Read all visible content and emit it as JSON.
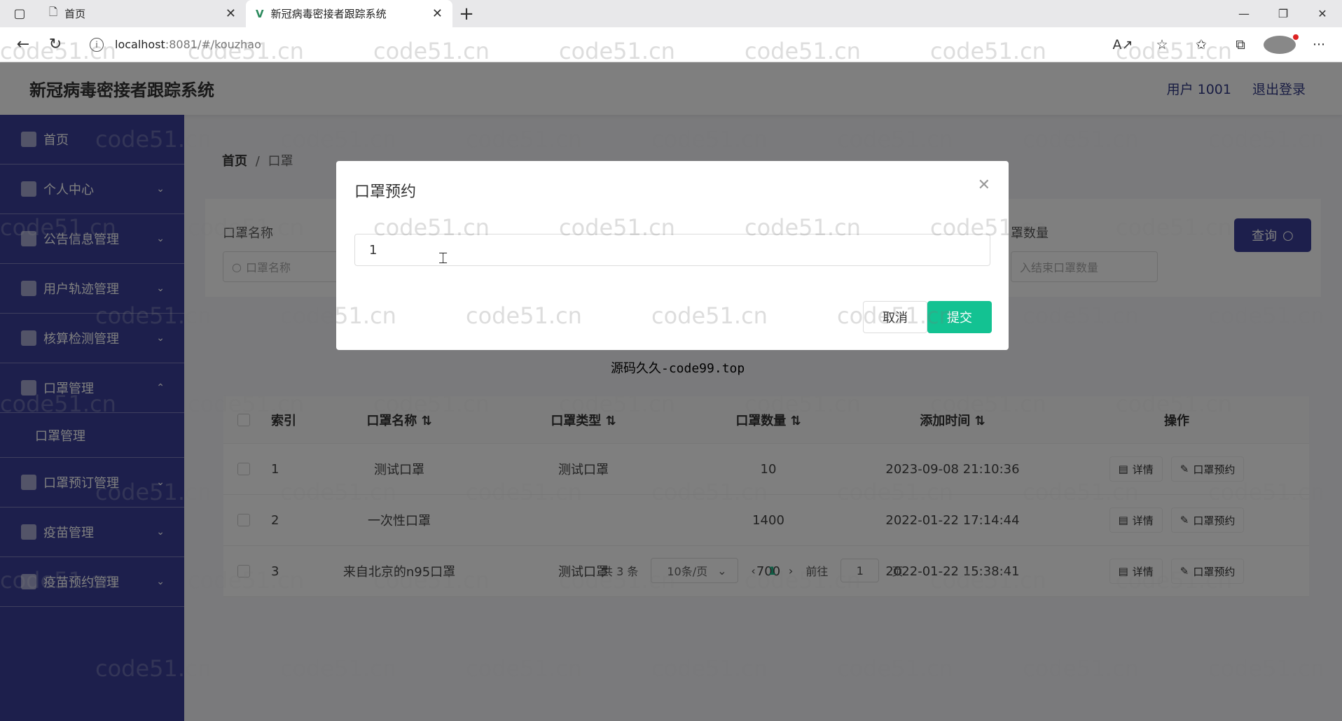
{
  "browser": {
    "tabs": [
      {
        "title": "首页"
      },
      {
        "title": "新冠病毒密接者跟踪系统"
      }
    ],
    "url_host": "localhost",
    "url_rest": ":8081/#/kouzhao"
  },
  "header": {
    "brand": "新冠病毒密接者跟踪系统",
    "user": "用户 1001",
    "logout": "退出登录"
  },
  "sidebar": {
    "items": [
      {
        "label": "首页"
      },
      {
        "label": "个人中心"
      },
      {
        "label": "公告信息管理"
      },
      {
        "label": "用户轨迹管理"
      },
      {
        "label": "核算检测管理"
      },
      {
        "label": "口罩管理"
      },
      {
        "label": "口罩预订管理"
      },
      {
        "label": "疫苗管理"
      },
      {
        "label": "疫苗预约管理"
      }
    ],
    "sub": {
      "label": "口罩管理"
    }
  },
  "breadcrumb": {
    "home": "首页",
    "sep": "/",
    "current": "口罩"
  },
  "search": {
    "label1": "口罩名称",
    "placeholder1": "口罩名称",
    "label2": "罩数量",
    "placeholder2": "入结束口罩数量",
    "button": "查询"
  },
  "table": {
    "headers": {
      "index": "索引",
      "name": "口罩名称",
      "type": "口罩类型",
      "count": "口罩数量",
      "time": "添加时间",
      "ops": "操作"
    },
    "rows": [
      {
        "index": "1",
        "name": "测试口罩",
        "type": "测试口罩",
        "count": "10",
        "time": "2023-09-08 21:10:36"
      },
      {
        "index": "2",
        "name": "一次性口罩",
        "type": "",
        "count": "1400",
        "time": "2022-01-22 17:14:44"
      },
      {
        "index": "3",
        "name": "来自北京的n95口罩",
        "type": "测试口罩",
        "count": "700",
        "time": "2022-01-22 15:38:41"
      }
    ],
    "op_detail": "详情",
    "op_reserve": "口罩预约"
  },
  "pagination": {
    "total": "共 3 条",
    "page_size": "10条/页",
    "prev": "‹",
    "current": "1",
    "next": "›",
    "goto": "前往",
    "goto_value": "1",
    "page_unit": "页"
  },
  "modal": {
    "title": "口罩预约",
    "input_value": "1",
    "cancel": "取消",
    "submit": "提交"
  },
  "overlay_caption": "源码久久-code99.top",
  "watermark": "code51.cn"
}
